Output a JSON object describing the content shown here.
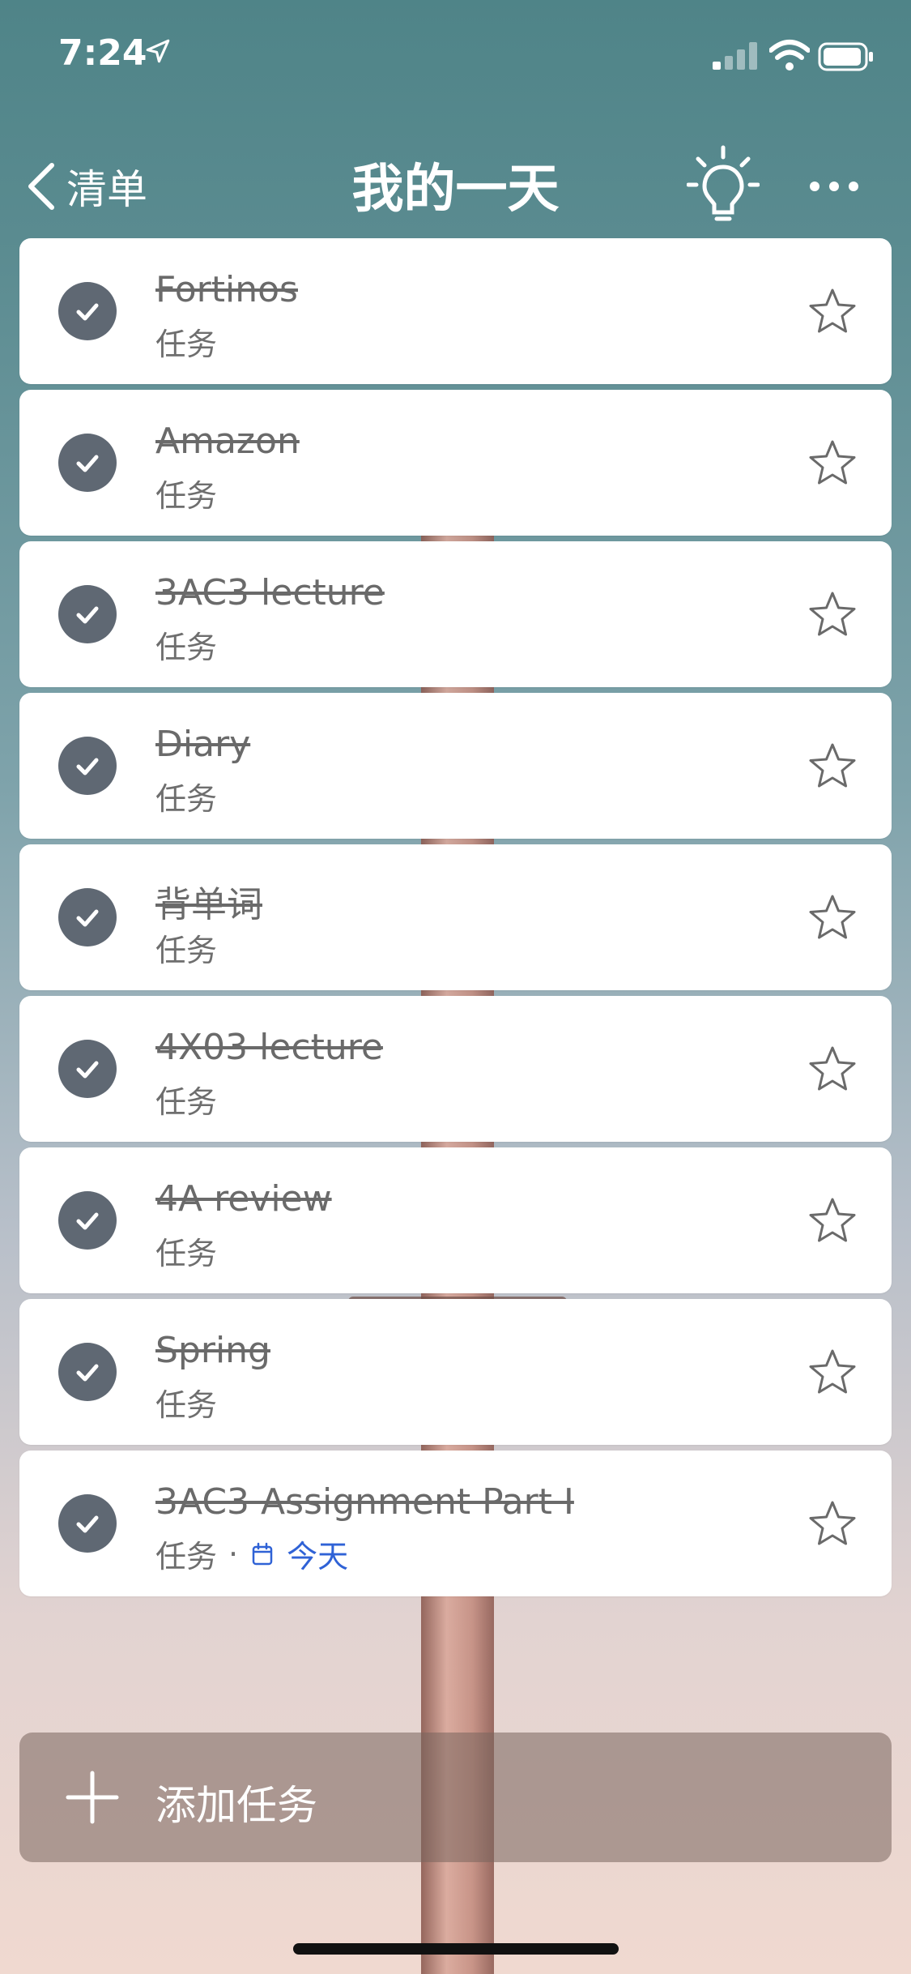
{
  "status_bar": {
    "time": "7:24"
  },
  "nav": {
    "back_label": "清单",
    "title": "我的一天"
  },
  "tasks": [
    {
      "title": "Fortinos",
      "list": "任务"
    },
    {
      "title": "Amazon",
      "list": "任务"
    },
    {
      "title": "3AC3 lecture",
      "list": "任务"
    },
    {
      "title": "Diary",
      "list": "任务"
    },
    {
      "title": "背单词",
      "list": "任务"
    },
    {
      "title": "4X03 lecture",
      "list": "任务"
    },
    {
      "title": "4A review",
      "list": "任务"
    },
    {
      "title": "Spring",
      "list": "任务"
    },
    {
      "title": "3AC3 Assignment Part I",
      "list": "任务",
      "separator": "·",
      "due": "今天"
    }
  ],
  "add_task": {
    "label": "添加任务"
  },
  "colors": {
    "check_fill": "#5f6873",
    "due_text": "#2f62d6",
    "card_bg": "#ffffff"
  }
}
